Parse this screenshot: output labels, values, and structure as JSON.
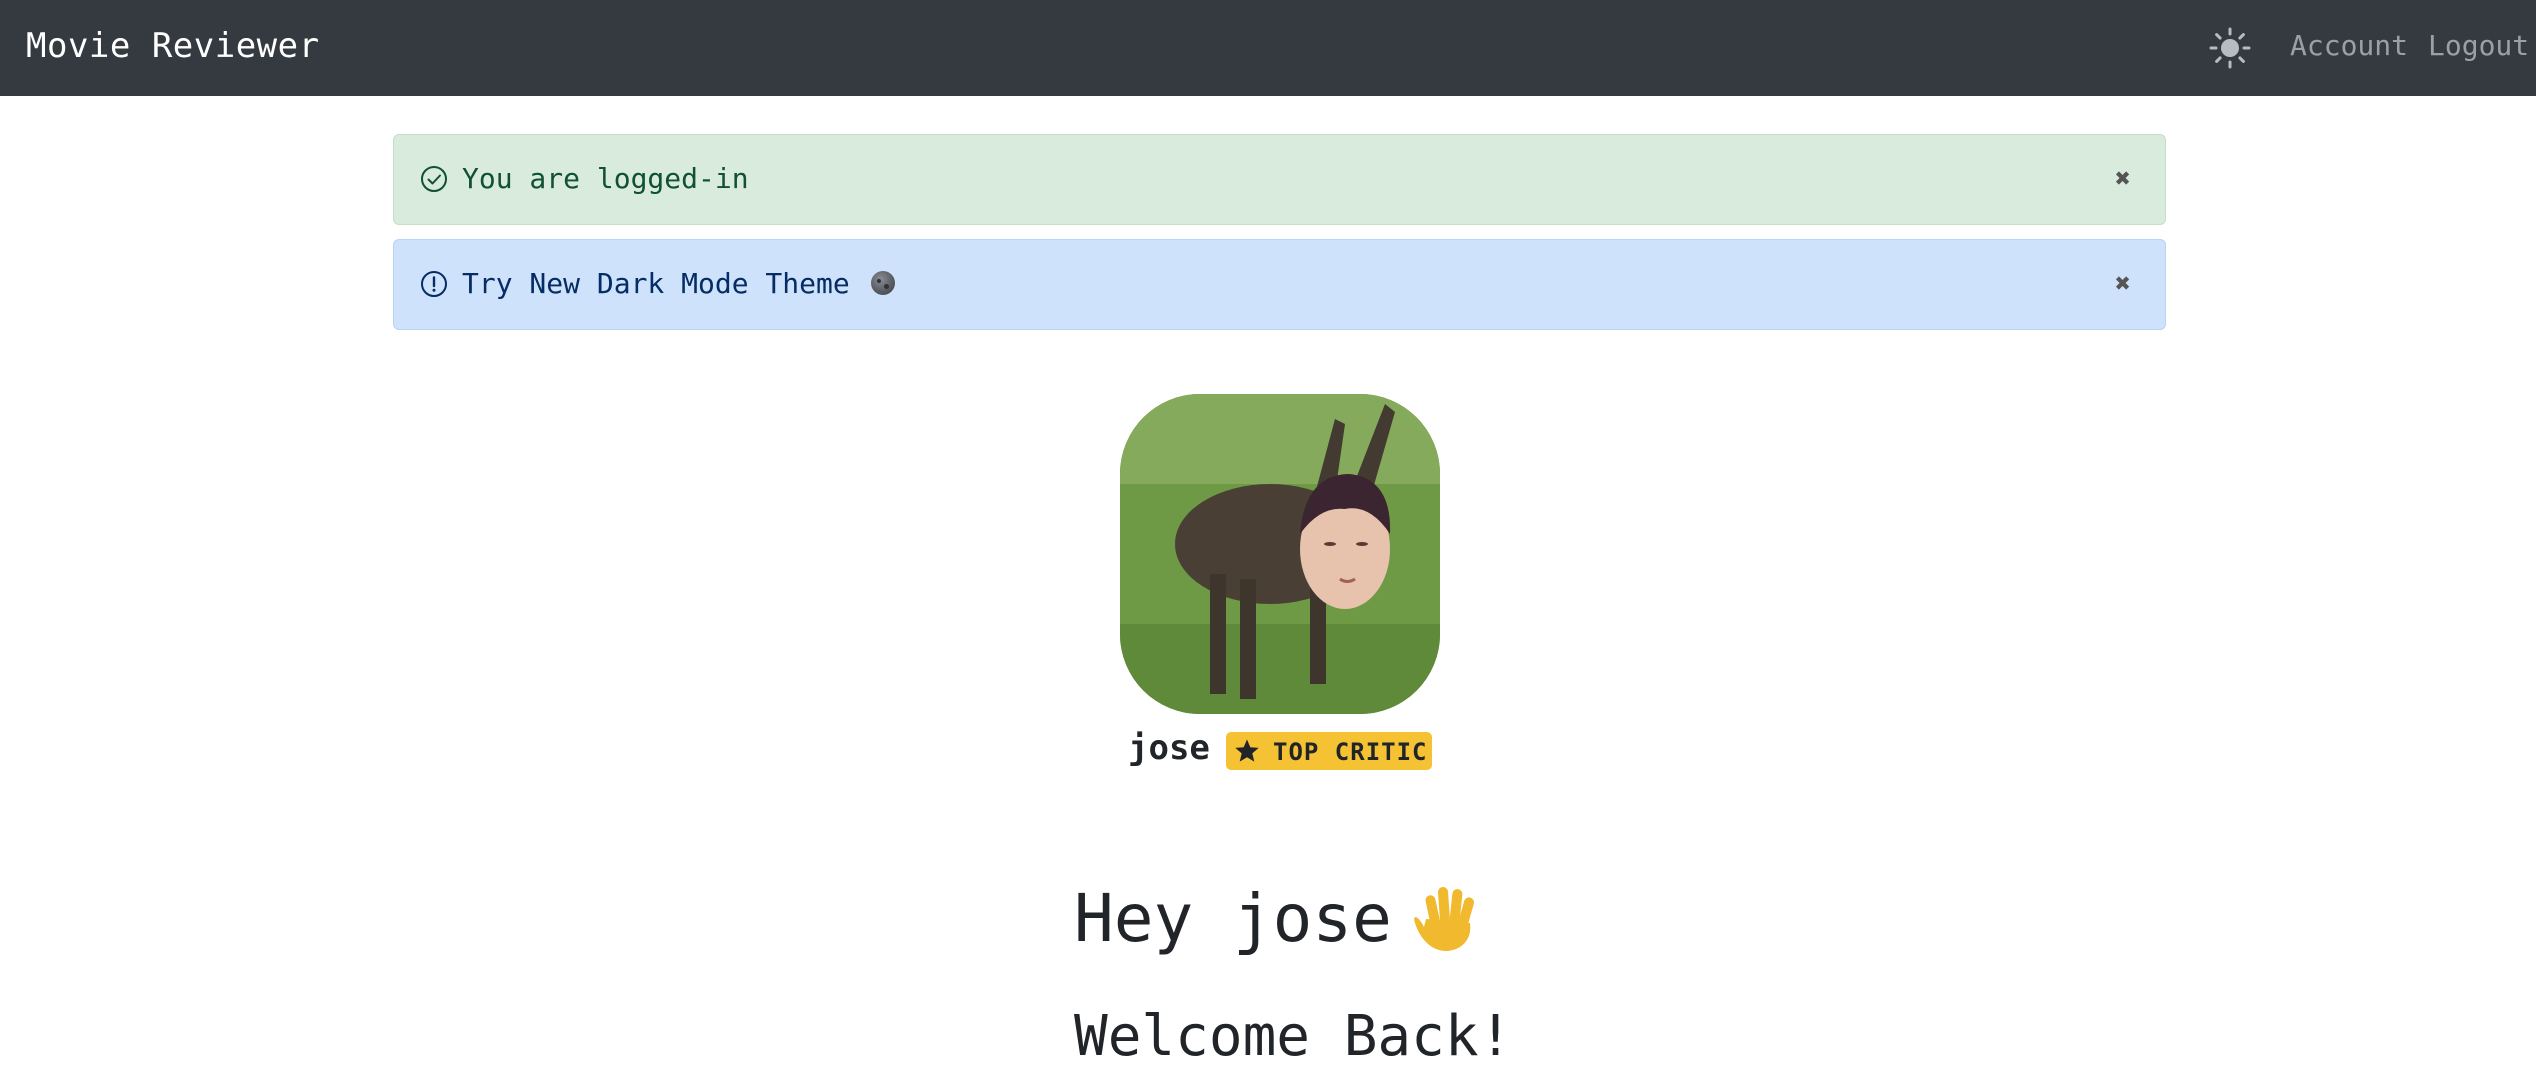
{
  "nav": {
    "brand": "Movie Reviewer",
    "theme_toggle_icon": "sun-icon",
    "account_label": "Account",
    "logout_label": "Logout"
  },
  "alerts": [
    {
      "type": "success",
      "icon": "check-circle-icon",
      "text": "You are logged-in",
      "close_icon": "close-icon",
      "close_label": "✖"
    },
    {
      "type": "info",
      "icon": "exclamation-circle-icon",
      "text": "Try New Dark Mode Theme",
      "emoji_icon": "new-moon-icon",
      "close_icon": "close-icon",
      "close_label": "✖"
    }
  ],
  "profile": {
    "avatar_icon": "avatar-image",
    "username": "jose",
    "badge": {
      "icon": "star-icon",
      "label": "TOP CRITIC"
    }
  },
  "greeting": {
    "text": "Hey jose",
    "icon": "waving-hand-icon",
    "subtitle": "Welcome Back!"
  },
  "colors": {
    "navbar": "#343a40",
    "success_bg": "#d9ebdc",
    "info_bg": "#cfe2fb",
    "badge": "#f4c233",
    "wave": "#f0b92e"
  }
}
